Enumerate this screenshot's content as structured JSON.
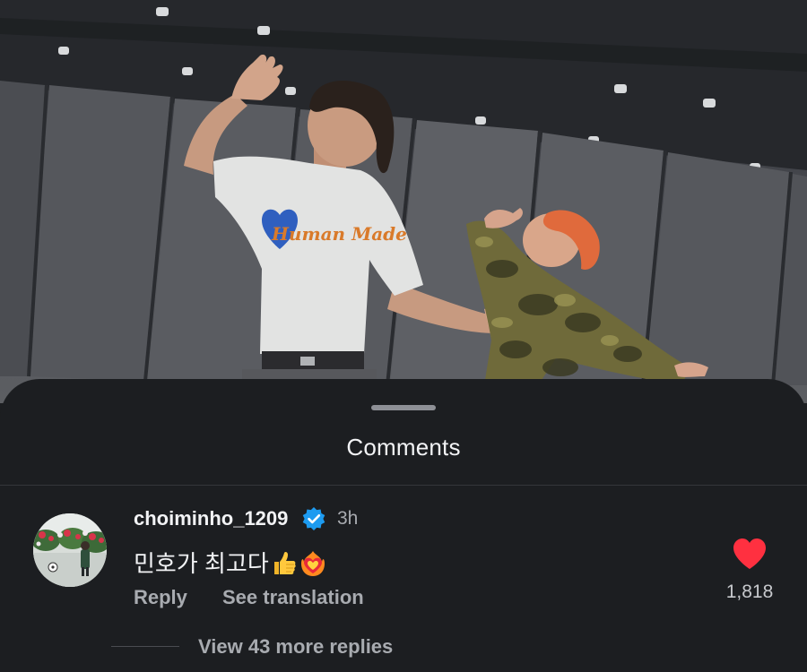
{
  "video": {
    "shirt_print": "Human Made"
  },
  "comments_sheet": {
    "title": "Comments",
    "comment": {
      "username": "choiminho_1209",
      "verified_icon": "verified-badge-icon",
      "timestamp": "3h",
      "text": "민호가 최고다",
      "emojis": [
        "thumbs-up-icon",
        "heart-on-fire-icon"
      ],
      "reply_label": "Reply",
      "translate_label": "See translation",
      "like_icon": "heart-icon",
      "like_count": "1,818",
      "view_replies_label": "View 43 more replies"
    }
  },
  "colors": {
    "sheet_background": "#1c1e21",
    "verified_blue": "#1d9bf0",
    "like_red": "#ff3040",
    "secondary_text": "#a8abb0"
  }
}
